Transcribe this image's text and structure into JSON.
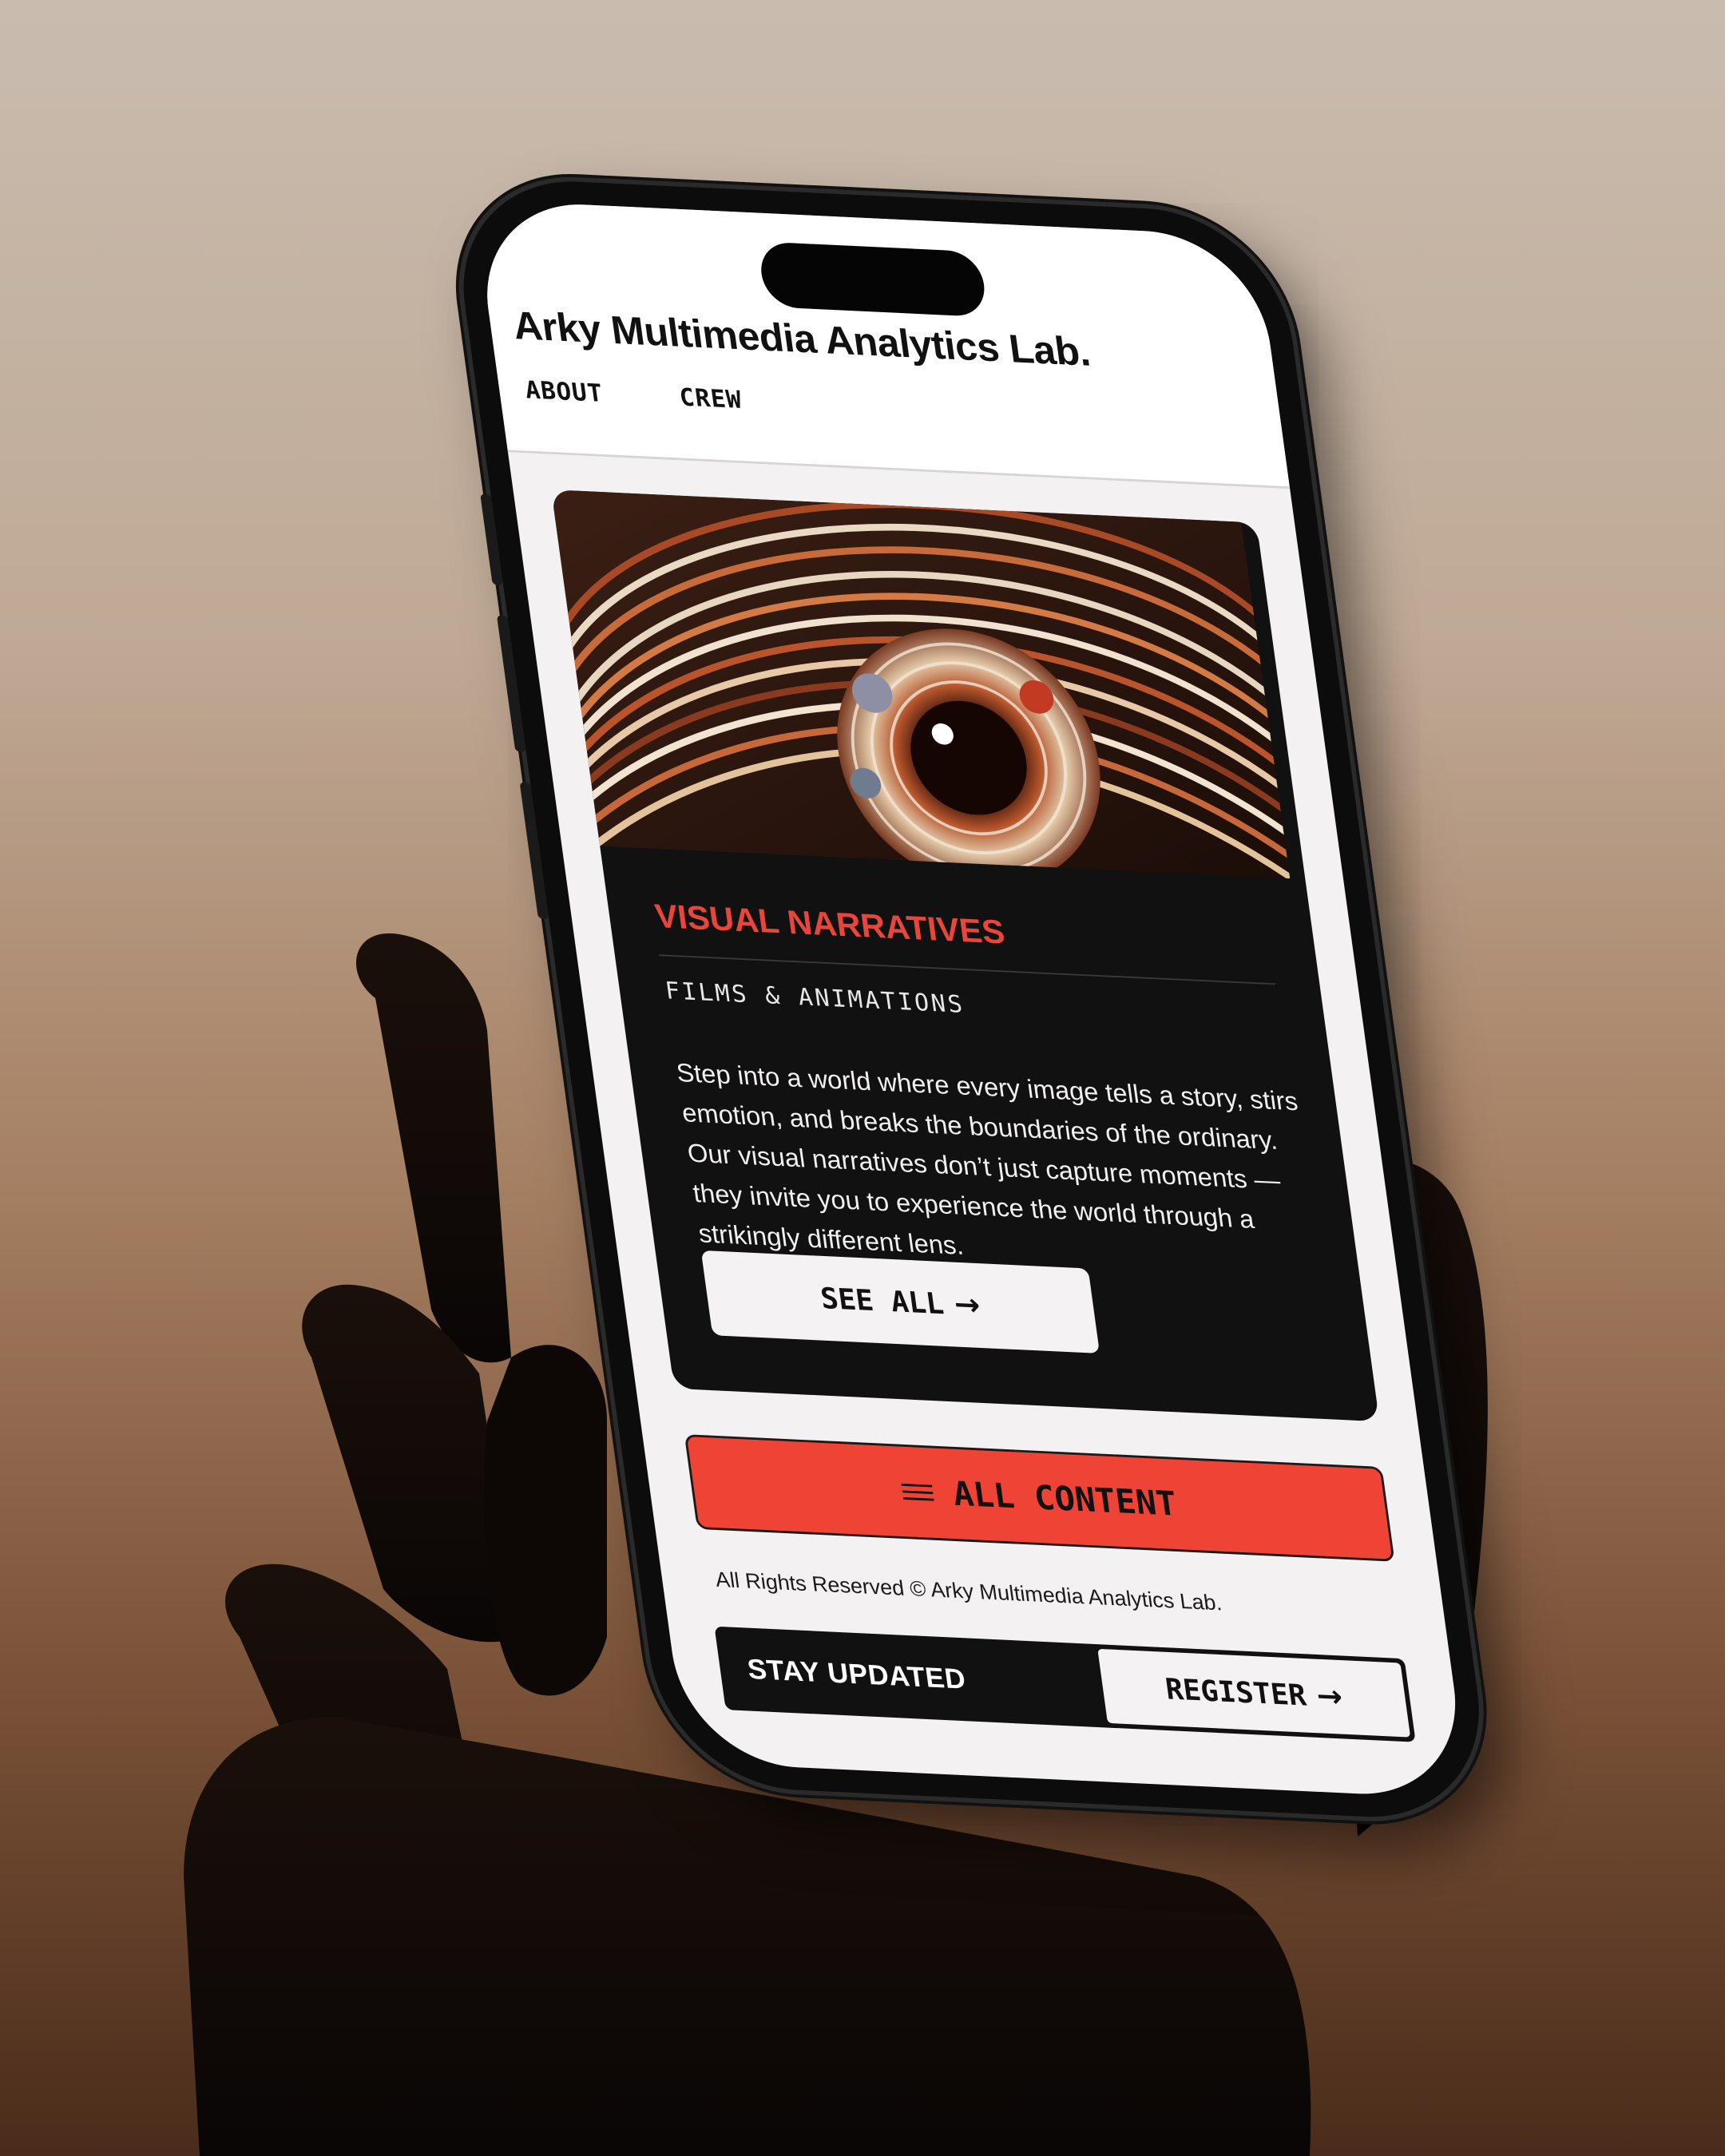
{
  "header": {
    "site_title": "Arky Multimedia Analytics Lab.",
    "nav": [
      {
        "label": "ABOUT"
      },
      {
        "label": "CREW"
      }
    ]
  },
  "card": {
    "image_description_icon": "eye-artwork-image",
    "title": "VISUAL NARRATIVES",
    "subtitle": "FILMS & ANIMATIONS",
    "description": "Step into a world where every image tells a story, stirs emotion, and breaks the boundaries of the ordinary. Our visual narratives don’t just capture moments — they invite you to experience the world through a strikingly different lens.",
    "button_label": "SEE ALL",
    "button_icon": "arrow-right-icon"
  },
  "all_content": {
    "label": "ALL CONTENT",
    "icon": "menu-icon"
  },
  "footer": {
    "copyright": "All Rights Reserved © Arky Multimedia Analytics Lab.",
    "newsletter_label": "STAY UPDATED",
    "register_label": "REGISTER",
    "register_icon": "arrow-right-icon"
  },
  "colors": {
    "accent": "#ef4336",
    "card_bg": "#121111",
    "screen_bg": "#f4f1f2"
  }
}
